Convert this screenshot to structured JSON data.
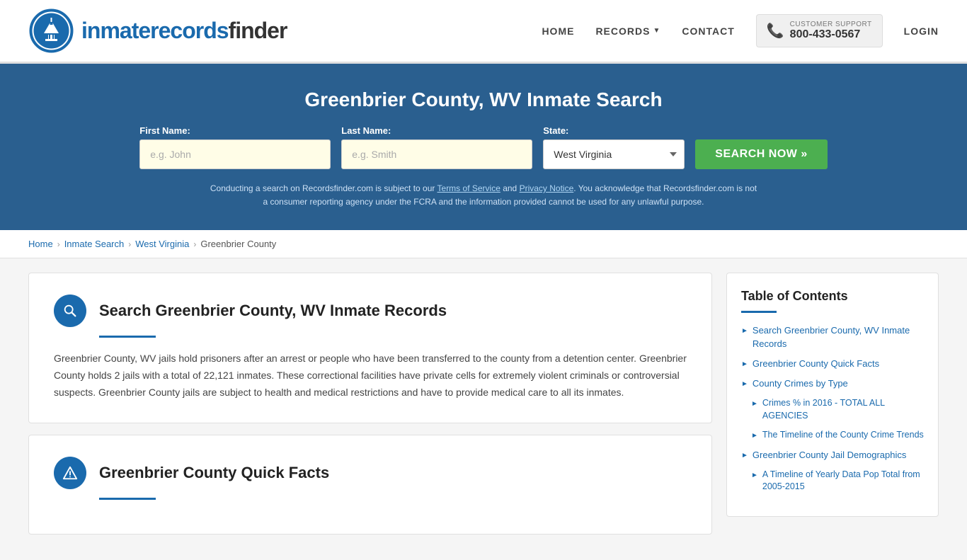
{
  "header": {
    "logo_text_normal": "inmaterecords",
    "logo_text_bold": "finder",
    "nav": {
      "home": "HOME",
      "records": "RECORDS",
      "contact": "CONTACT",
      "login": "LOGIN"
    },
    "support": {
      "label": "CUSTOMER SUPPORT",
      "phone": "800-433-0567"
    }
  },
  "hero": {
    "title": "Greenbrier County, WV Inmate Search",
    "first_name_label": "First Name:",
    "first_name_placeholder": "e.g. John",
    "last_name_label": "Last Name:",
    "last_name_placeholder": "e.g. Smith",
    "state_label": "State:",
    "state_value": "West Virginia",
    "search_button": "SEARCH NOW »",
    "legal_text_1": "Conducting a search on Recordsfinder.com is subject to our ",
    "tos_link": "Terms of Service",
    "legal_and": " and ",
    "privacy_link": "Privacy Notice",
    "legal_text_2": ". You acknowledge that Recordsfinder.com is not a consumer reporting agency under the FCRA and the information provided cannot be used for any unlawful purpose."
  },
  "breadcrumb": {
    "home": "Home",
    "inmate_search": "Inmate Search",
    "west_virginia": "West Virginia",
    "greenbrier_county": "Greenbrier County"
  },
  "main": {
    "section1": {
      "title": "Search Greenbrier County, WV Inmate Records",
      "body": "Greenbrier County, WV jails hold prisoners after an arrest or people who have been transferred to the county from a detention center. Greenbrier County holds 2 jails with a total of 22,121 inmates. These correctional facilities have private cells for extremely violent criminals or controversial suspects. Greenbrier County jails are subject to health and medical restrictions and have to provide medical care to all its inmates."
    },
    "section2": {
      "title": "Greenbrier County Quick Facts"
    }
  },
  "toc": {
    "title": "Table of Contents",
    "items": [
      {
        "label": "Search Greenbrier County, WV Inmate Records",
        "level": 1
      },
      {
        "label": "Greenbrier County Quick Facts",
        "level": 1
      },
      {
        "label": "County Crimes by Type",
        "level": 1
      },
      {
        "label": "Crimes % in 2016 - TOTAL ALL AGENCIES",
        "level": 2
      },
      {
        "label": "The Timeline of the County Crime Trends",
        "level": 2
      },
      {
        "label": "Greenbrier County Jail Demographics",
        "level": 1
      },
      {
        "label": "A Timeline of Yearly Data Pop Total from 2005-2015",
        "level": 2
      }
    ]
  }
}
